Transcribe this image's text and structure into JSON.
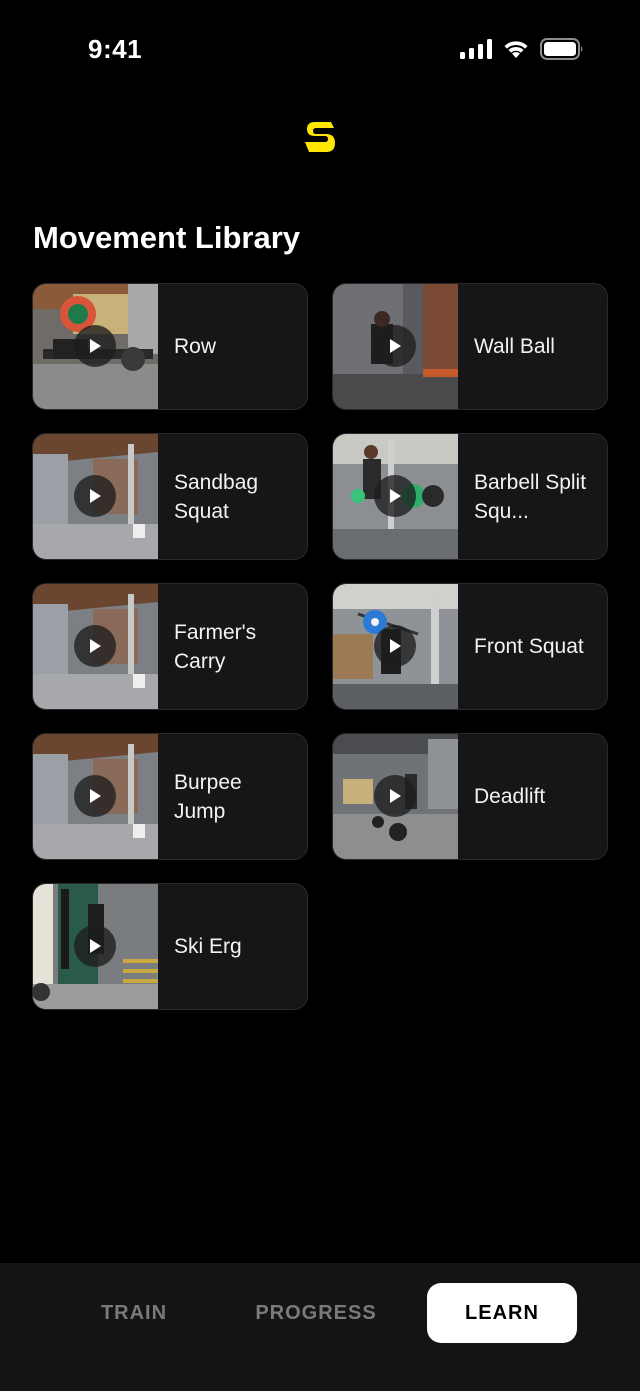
{
  "status_bar": {
    "time": "9:41"
  },
  "header": {
    "logo_icon": "brand-s-logo",
    "accent": "#FFE600"
  },
  "section": {
    "title": "Movement Library"
  },
  "movements": [
    {
      "label": "Row"
    },
    {
      "label": "Wall Ball"
    },
    {
      "label": "Sandbag Squat"
    },
    {
      "label": "Barbell Split Squ..."
    },
    {
      "label": "Farmer's Carry"
    },
    {
      "label": "Front Squat"
    },
    {
      "label": "Burpee Jump"
    },
    {
      "label": "Deadlift"
    },
    {
      "label": "Ski Erg"
    }
  ],
  "nav": {
    "tabs": [
      {
        "label": "TRAIN"
      },
      {
        "label": "PROGRESS"
      },
      {
        "label": "LEARN"
      }
    ],
    "active": "LEARN"
  }
}
